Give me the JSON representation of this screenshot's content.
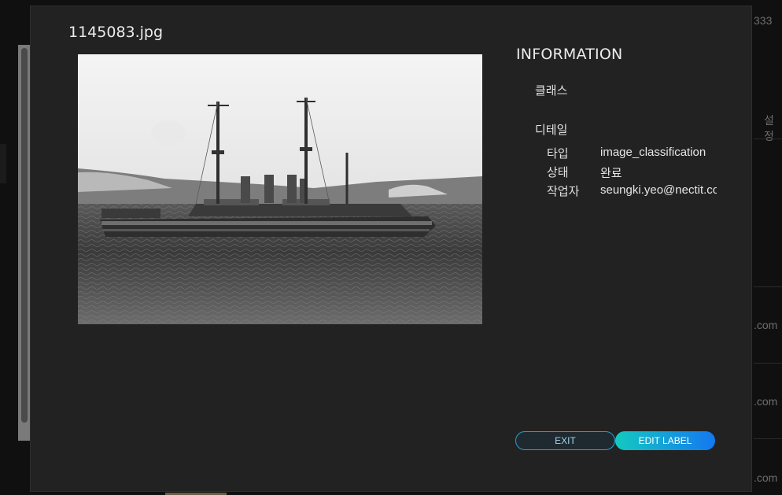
{
  "background": {
    "count_fragment": "333",
    "header_fragment": "설정",
    "row_fragments": [
      ".com",
      ".com",
      ".com"
    ]
  },
  "modal": {
    "file_name": "1145083.jpg",
    "info_title": "INFORMATION",
    "class_label": "클래스",
    "detail_label": "디테일",
    "details": [
      {
        "key": "타입",
        "value": "image_classification"
      },
      {
        "key": "상태",
        "value": "완료"
      },
      {
        "key": "작업자",
        "value": "seungki.yeo@nectit.com"
      }
    ],
    "buttons": {
      "exit": "EXIT",
      "edit_label": "EDIT LABEL"
    },
    "colors": {
      "accent_start": "#14c9c0",
      "accent_end": "#1478f0",
      "exit_border": "#2aa0c8"
    }
  }
}
